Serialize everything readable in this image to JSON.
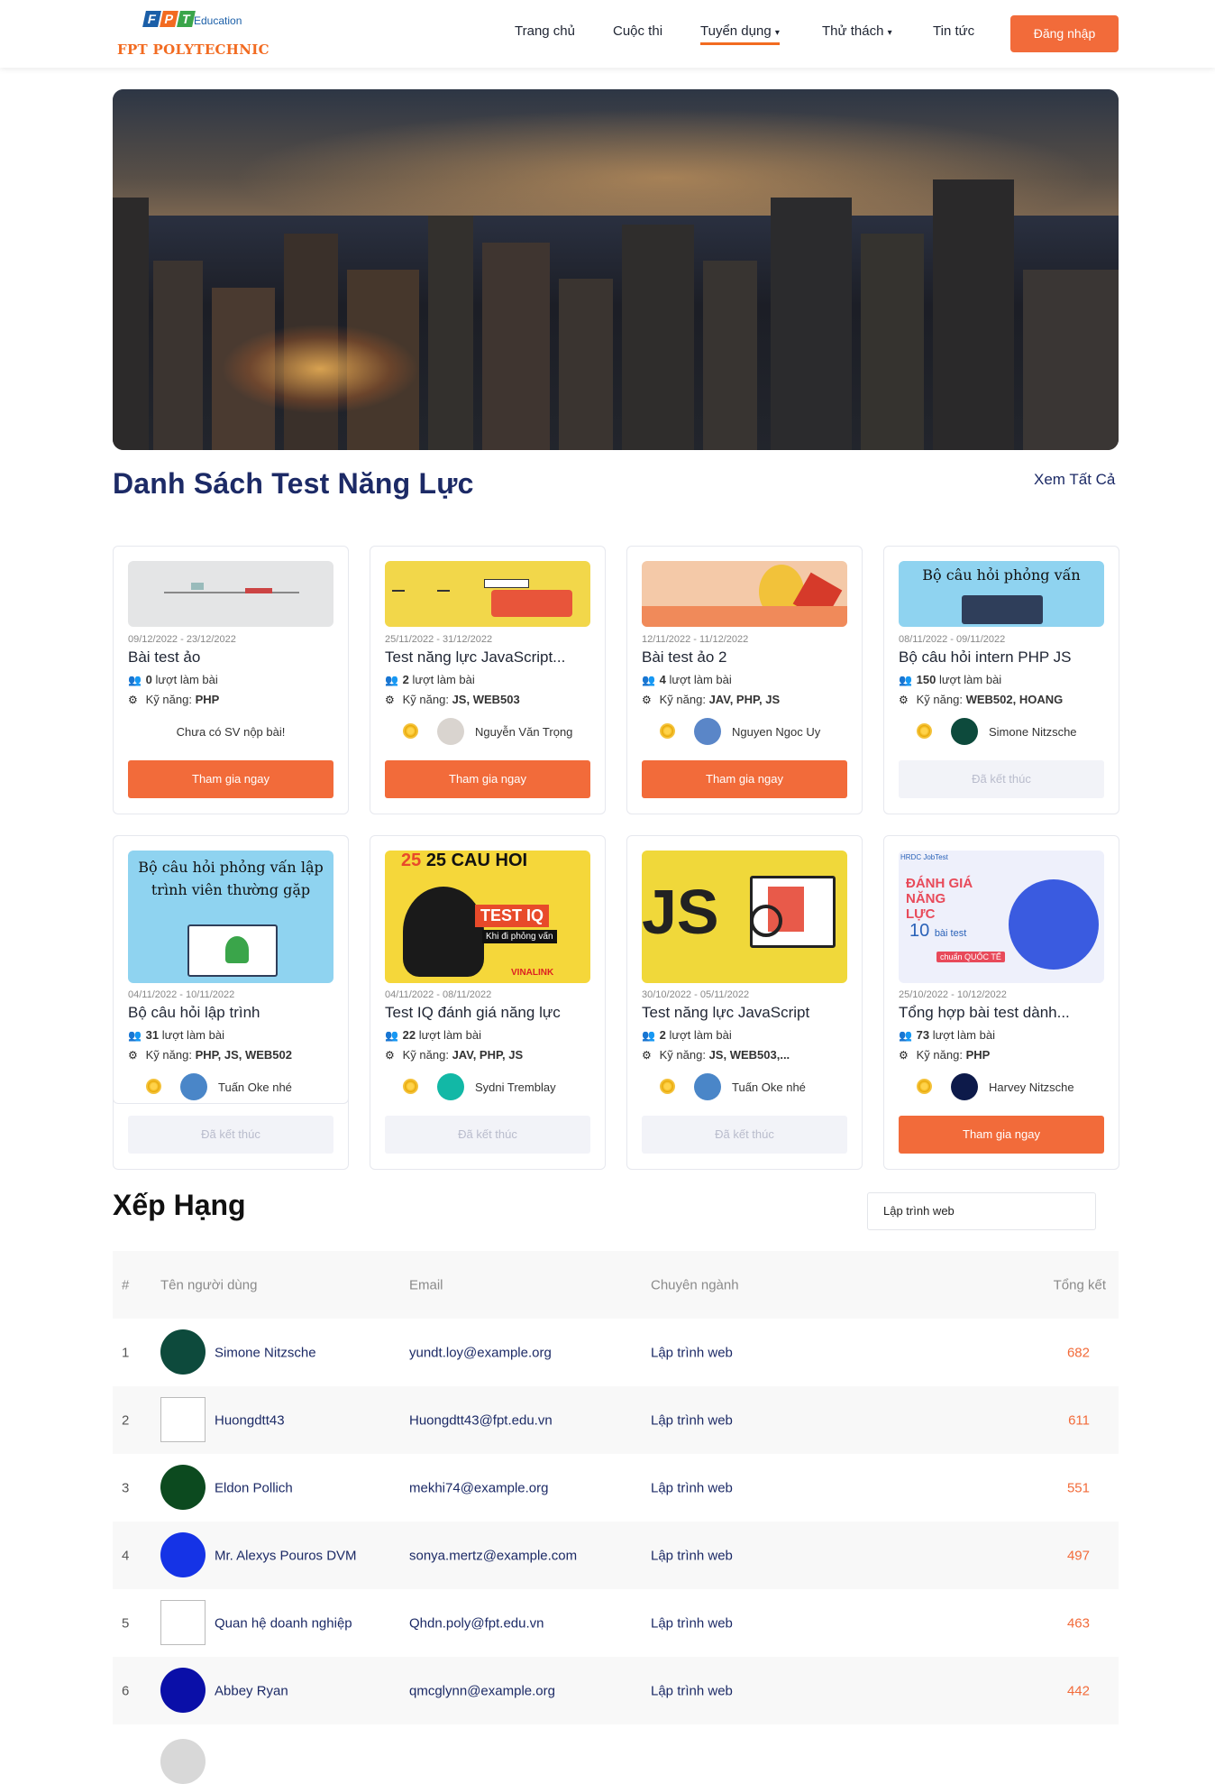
{
  "header": {
    "logo_brand": "FPT",
    "logo_sub": "Education",
    "logo_name": "FPT POLYTECHNIC",
    "nav": [
      {
        "label": "Trang chủ"
      },
      {
        "label": "Cuộc thi"
      },
      {
        "label": "Tuyển dụng",
        "caret": "▾"
      },
      {
        "label": "Thử thách",
        "caret": "▾"
      },
      {
        "label": "Tin tức"
      }
    ],
    "login_label": "Đăng nhập"
  },
  "colors": {
    "accent": "#f26b3a",
    "title_blue": "#1c2a66"
  },
  "tests_section": {
    "title": "Danh Sách Test Năng Lực",
    "see_all": "Xem Tất Cả",
    "cards": [
      {
        "date": "09/12/2022 - 23/12/2022",
        "title": "Bài test ảo",
        "attempts_num": "0",
        "attempts_label": "lượt làm bài",
        "skills_label": "Kỹ năng:",
        "skills": "PHP",
        "top_user": "",
        "no_submit": "Chưa có SV nộp bài!",
        "button": "Tham gia ngay",
        "active": true
      },
      {
        "date": "25/11/2022 - 31/12/2022",
        "title": "Test năng lực JavaScript...",
        "attempts_num": "2",
        "attempts_label": "lượt làm bài",
        "skills_label": "Kỹ năng:",
        "skills": "JS, WEB503",
        "top_user": "Nguyễn Văn Trọng",
        "button": "Tham gia ngay",
        "active": true
      },
      {
        "date": "12/11/2022 - 11/12/2022",
        "title": "Bài test ảo 2",
        "attempts_num": "4",
        "attempts_label": "lượt làm bài",
        "skills_label": "Kỹ năng:",
        "skills": "JAV, PHP, JS",
        "top_user": "Nguyen Ngoc Uy",
        "button": "Tham gia ngay",
        "active": true
      },
      {
        "date": "08/11/2022 - 09/11/2022",
        "title": "Bộ câu hỏi intern PHP JS",
        "attempts_num": "150",
        "attempts_label": "lượt làm bài",
        "skills_label": "Kỹ năng:",
        "skills": "WEB502, HOANG",
        "top_user": "Simone Nitzsche",
        "button": "Đã kết thúc",
        "active": false,
        "thumb_text": "Bộ câu hỏi phỏng vấn"
      },
      {
        "date": "04/11/2022 - 10/11/2022",
        "title": "Bộ câu hỏi lập trình",
        "attempts_num": "31",
        "attempts_label": "lượt làm bài",
        "skills_label": "Kỹ năng:",
        "skills": "PHP, JS, WEB502",
        "top_user": "Tuấn Oke nhé",
        "button": "Đã kết thúc",
        "active": false,
        "thumb_text": "Bộ câu hỏi phỏng vấn lập trình viên thường gặp"
      },
      {
        "date": "04/11/2022 - 08/11/2022",
        "title": "Test IQ đánh giá năng lực",
        "attempts_num": "22",
        "attempts_label": "lượt làm bài",
        "skills_label": "Kỹ năng:",
        "skills": "JAV, PHP, JS",
        "top_user": "Sydni Tremblay",
        "button": "Đã kết thúc",
        "active": false,
        "thumb_text": "25 CAU HOI",
        "thumb_text2": "TEST IQ",
        "thumb_text3": "Khi đi phỏng vấn",
        "thumb_text4": "VINALINK"
      },
      {
        "date": "30/10/2022 - 05/11/2022",
        "title": "Test năng lực JavaScript",
        "attempts_num": "2",
        "attempts_label": "lượt làm bài",
        "skills_label": "Kỹ năng:",
        "skills": "JS, WEB503,...",
        "top_user": "Tuấn Oke nhé",
        "button": "Đã kết thúc",
        "active": false,
        "thumb_text": "JS"
      },
      {
        "date": "25/10/2022 - 10/12/2022",
        "title": "Tổng hợp bài test dành...",
        "attempts_num": "73",
        "attempts_label": "lượt làm bài",
        "skills_label": "Kỹ năng:",
        "skills": "PHP",
        "top_user": "Harvey Nitzsche",
        "button": "Tham gia ngay",
        "active": true,
        "thumb_text": "ĐÁNH GIÁ NĂNG LỰC",
        "thumb_text2": "10",
        "thumb_text3": "bài test",
        "thumb_text4": "chuẩn QUỐC TẾ",
        "thumb_brand": "HRDC JobTest"
      }
    ]
  },
  "ranking": {
    "title": "Xếp Hạng",
    "filter_value": "Lập trình web",
    "columns": {
      "rank": "#",
      "name": "Tên người dùng",
      "email": "Email",
      "major": "Chuyên ngành",
      "score": "Tổng kết"
    },
    "rows": [
      {
        "rank": "1",
        "name": "Simone Nitzsche",
        "email": "yundt.loy@example.org",
        "major": "Lập trình web",
        "score": "682",
        "avatar": "#0d4a3c"
      },
      {
        "rank": "2",
        "name": "Huongdtt43",
        "email": "Huongdtt43@fpt.edu.vn",
        "major": "Lập trình web",
        "score": "611",
        "avatar": "broken"
      },
      {
        "rank": "3",
        "name": "Eldon Pollich",
        "email": "mekhi74@example.org",
        "major": "Lập trình web",
        "score": "551",
        "avatar": "#0c4a1f"
      },
      {
        "rank": "4",
        "name": "Mr. Alexys Pouros DVM",
        "email": "sonya.mertz@example.com",
        "major": "Lập trình web",
        "score": "497",
        "avatar": "#1533e6"
      },
      {
        "rank": "5",
        "name": "Quan hệ doanh nghiệp",
        "email": "Qhdn.poly@fpt.edu.vn",
        "major": "Lập trình web",
        "score": "463",
        "avatar": "broken"
      },
      {
        "rank": "6",
        "name": "Abbey Ryan",
        "email": "qmcglynn@example.org",
        "major": "Lập trình web",
        "score": "442",
        "avatar": "#0a0fa8"
      }
    ]
  }
}
